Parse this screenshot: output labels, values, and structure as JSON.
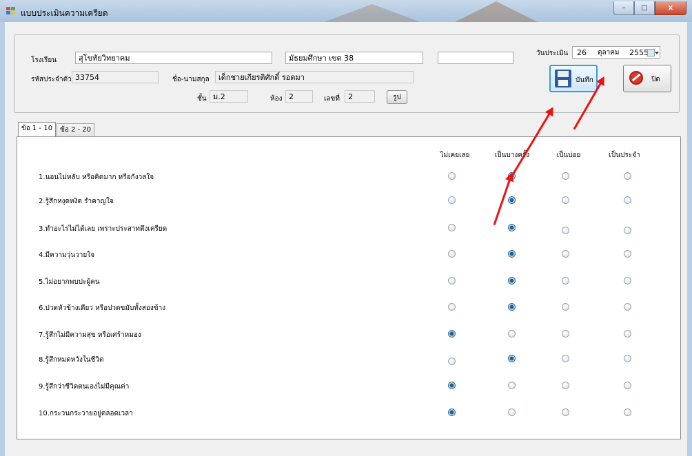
{
  "window": {
    "title": "แบบประเมินความเครียด",
    "minimize_glyph": "–",
    "maximize_glyph": "□",
    "close_glyph": "x"
  },
  "form": {
    "school_label": "โรงเรียน",
    "school_value": "สุโขทัยวิทยาคม",
    "area_value": "มัธยมศึกษา เขต 38",
    "extra_value": "",
    "student_id_label": "รหัสประจำตัว",
    "student_id_value": "33754",
    "name_label": "ชื่อ-นามสกุล",
    "name_value": "เด็กชายเกียรติศักดิ์ รอดมา",
    "class_label": "ชั้น",
    "class_value": "ม.2",
    "room_label": "ห้อง",
    "room_value": "2",
    "number_label": "เลขที่",
    "number_value": "2",
    "photo_button": "รูป",
    "date_label": "วันประเมิน",
    "date_day": "26",
    "date_month": "ตุลาคม",
    "date_year": "2555",
    "save_button": "บันทึก",
    "close_button": "ปิด"
  },
  "tabs": [
    {
      "label": "ข้อ 1 - 10"
    },
    {
      "label": "ข้อ 2 - 20"
    }
  ],
  "columns": [
    "ไม่เคยเลย",
    "เป็นบางครั้ง",
    "เป็นบ่อย",
    "เป็นประจำ"
  ],
  "questions": [
    {
      "text": "1.นอนไม่หลับ หรือคิดมาก หรือกังวลใจ",
      "selected": 1
    },
    {
      "text": "2.รู้สึกหงุดหงิด รำคาญใจ",
      "selected": 1
    },
    {
      "text": "3.ทำอะไรไม่ได้เลย เพราะประสาทตึงเครียด",
      "selected": 1
    },
    {
      "text": "4.มีความวุ่นวายใจ",
      "selected": 1
    },
    {
      "text": "5.ไม่อยากพบปะผู้คน",
      "selected": 1
    },
    {
      "text": "6.ปวดหัวข้างเดียว หรือปวดขมับทั้งสองข้าง",
      "selected": 1
    },
    {
      "text": "7.รู้สึกไม่มีความสุข หรือเศร้าหมอง",
      "selected": 0
    },
    {
      "text": "8.รู้สึกหมดหวังในชีวิต",
      "selected": 1
    },
    {
      "text": "9.รู้สึกว่าชีวิตตนเองไม่มีคุณค่า",
      "selected": 0
    },
    {
      "text": "10.กระวนกระวายอยู่ตลอดเวลา",
      "selected": 0
    }
  ],
  "colors": {
    "accent": "#3d9bd6",
    "arrow": "#ee1111",
    "close_red": "#c8452b"
  }
}
